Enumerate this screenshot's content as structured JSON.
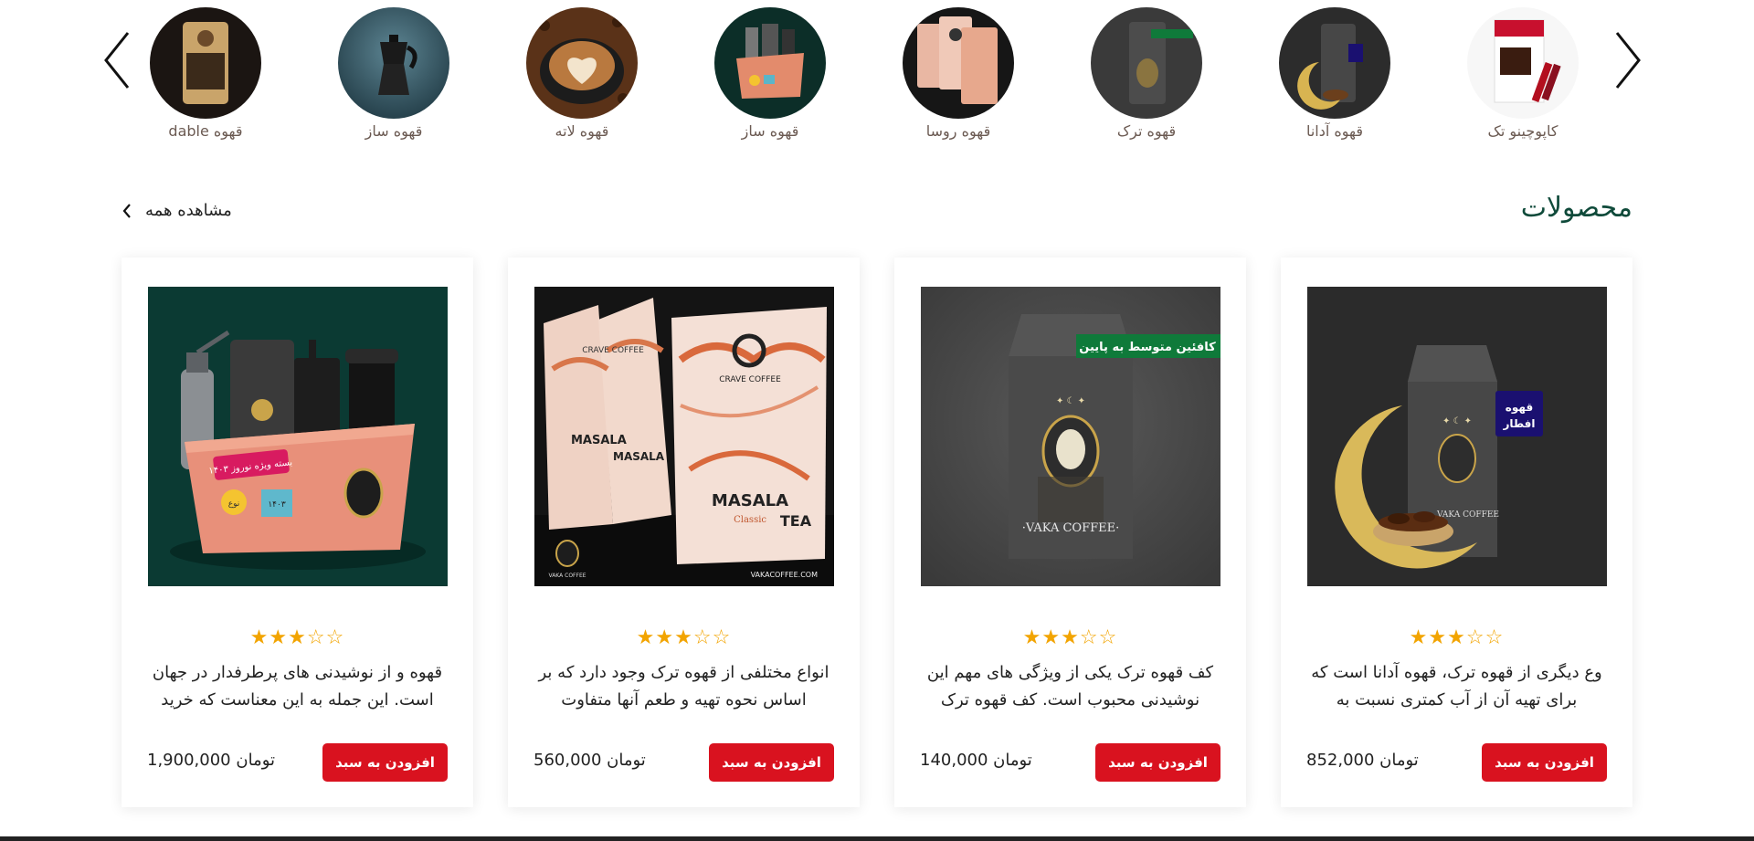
{
  "carousel": {
    "prev_icon": "chevron-left-icon",
    "next_icon": "chevron-right-icon",
    "categories": [
      {
        "label": "قهوه dable"
      },
      {
        "label": "قهوه ساز"
      },
      {
        "label": "قهوه لاته"
      },
      {
        "label": "قهوه ساز"
      },
      {
        "label": "قهوه روسا"
      },
      {
        "label": "قهوه ترک"
      },
      {
        "label": "قهوه آدانا"
      },
      {
        "label": "کاپوچینو تک"
      }
    ]
  },
  "products_section": {
    "title": "محصولات",
    "view_all": "مشاهده همه"
  },
  "products": [
    {
      "rating": 3,
      "max_rating": 5,
      "description": "قهوه و از نوشیدنی های پرطرفدار در جهان است. این جمله به این معناست که خرید",
      "button": "افزودن به سبد",
      "price": "1,900,000 تومان",
      "image_text": {
        "sticker": "بسته ویژه نوروز ۱۴۰۳",
        "tag1": "نوع",
        "tag2": "۱۴۰۳"
      }
    },
    {
      "rating": 3,
      "max_rating": 5,
      "description": "انواع مختلفی از قهوه ترک وجود دارد که بر اساس نحوه تهیه و طعم آنها متفاوت",
      "button": "افزودن به سبد",
      "price": "560,000 تومان",
      "image_text": {
        "brand": "CRAVE COFFEE",
        "name1": "MASALA",
        "name2": "TEA",
        "variant": "Classic",
        "maker": "VAKA COFFEE",
        "site": "VAKACOFFEE.COM"
      }
    },
    {
      "rating": 3,
      "max_rating": 5,
      "description": "کف قهوه ترک یکی از ویژگی های مهم این نوشیدنی محبوب است. کف قهوه ترک",
      "button": "افزودن به سبد",
      "price": "140,000 تومان",
      "image_text": {
        "badge": "کافئین متوسط به پایین",
        "brand": "·VAKA COFFEE·"
      }
    },
    {
      "rating": 3,
      "max_rating": 5,
      "description": "وع دیگری از قهوه ترک، قهوه آدانا است که برای تهیه آن از آب کمتری نسبت به",
      "button": "افزودن به سبد",
      "price": "852,000 تومان",
      "image_text": {
        "badge1": "قهوه",
        "badge2": "افطار",
        "brand": "VAKA COFFEE"
      }
    }
  ],
  "colors": {
    "accent_red": "#d9121f",
    "title_green": "#0f4a3a",
    "star": "#f2a400",
    "badge_green": "#0f7a3a",
    "badge_navy": "#1a1070"
  }
}
